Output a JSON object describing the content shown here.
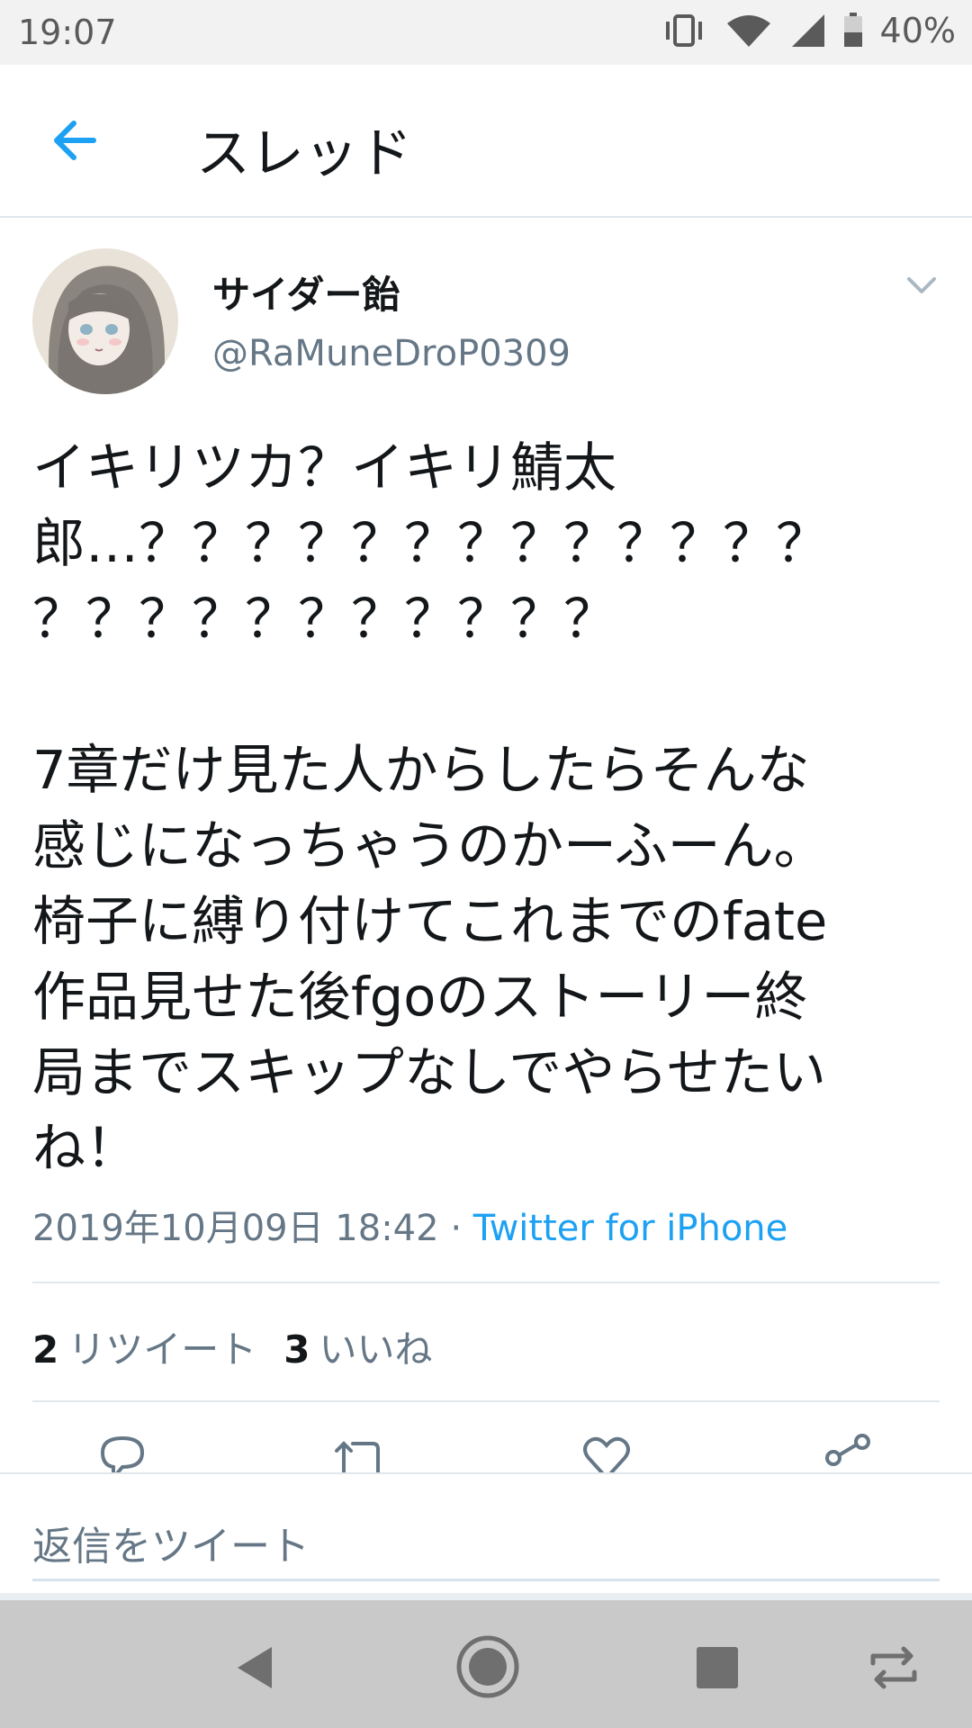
{
  "status_bar": {
    "time": "19:07",
    "battery_percent": "40%",
    "icons": [
      "vibrate-icon",
      "wifi-icon",
      "signal-icon",
      "battery-icon"
    ]
  },
  "header": {
    "title": "スレッド",
    "back_icon": "back-arrow-icon"
  },
  "tweet": {
    "author": {
      "display_name": "サイダー飴",
      "handle": "@RaMuneDroP0309"
    },
    "text": "イキリツカ？イキリ鯖太\n郎…？？？？？？？？？？？？？\n？？？？？？？？？？？\n\n7章だけ見た人からしたらそんな\n感じになっちゃうのかーふーん。\n椅子に縛り付けてこれまでのfate\n作品見せた後fgoのストーリー終\n局までスキップなしでやらせたい\nね！",
    "timestamp": "2019年10月09日 18:42",
    "separator": "·",
    "source": "Twitter for iPhone",
    "retweet_count": "2",
    "retweet_label": "リツイート",
    "like_count": "3",
    "like_label": "いいね"
  },
  "actions": [
    "reply-icon",
    "retweet-icon",
    "like-icon",
    "share-icon"
  ],
  "reply_bar": {
    "placeholder": "返信をツイート"
  },
  "nav_bar": [
    "back-triangle-icon",
    "home-circle-icon",
    "recents-square-icon",
    "rotate-icon"
  ],
  "colors": {
    "accent": "#1da1f2",
    "text": "#14171a",
    "secondary": "#657786",
    "divider": "#e1e8ed"
  }
}
